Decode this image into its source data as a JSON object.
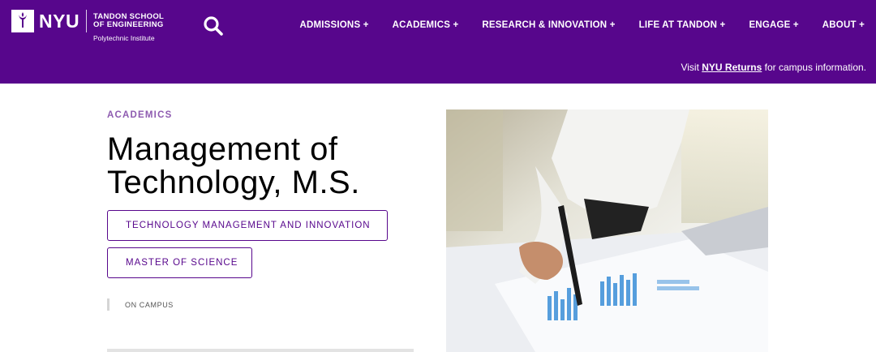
{
  "header": {
    "logo": {
      "wordmark": "NYU",
      "school_line1": "TANDON SCHOOL",
      "school_line2": "OF ENGINEERING",
      "subtitle": "Polytechnic Institute"
    },
    "search_icon": "search-icon",
    "nav": [
      {
        "label": "ADMISSIONS +"
      },
      {
        "label": "ACADEMICS +"
      },
      {
        "label": "RESEARCH & INNOVATION +"
      },
      {
        "label": "LIFE AT TANDON +"
      },
      {
        "label": "ENGAGE +"
      },
      {
        "label": "ABOUT +"
      }
    ],
    "notice": {
      "prefix": "Visit ",
      "link": "NYU Returns",
      "suffix": " for campus information."
    }
  },
  "main": {
    "eyebrow": "ACADEMICS",
    "title": "Management of Technology, M.S.",
    "tags": [
      {
        "label": "TECHNOLOGY MANAGEMENT AND INNOVATION"
      },
      {
        "label": "MASTER OF SCIENCE"
      }
    ],
    "campus": "ON CAMPUS"
  },
  "colors": {
    "brand_purple": "#57068c",
    "eyebrow_purple": "#8e5bb0",
    "text": "#000000"
  }
}
